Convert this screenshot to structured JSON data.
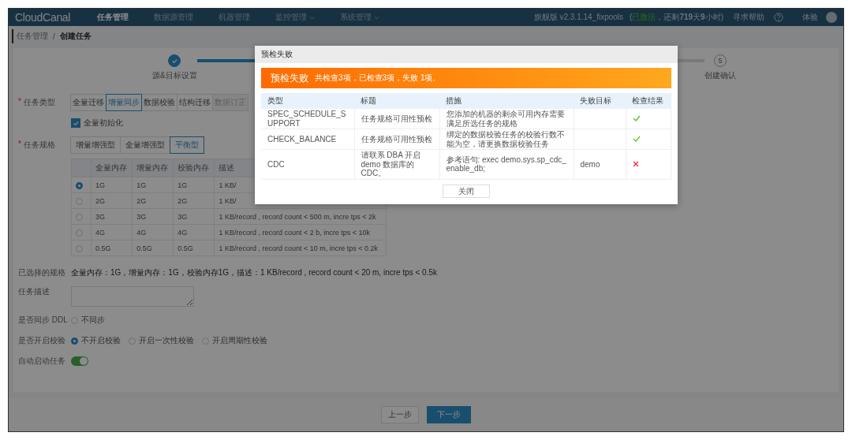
{
  "nav": {
    "logo": "CloudCanal",
    "items": [
      {
        "label": "任务管理",
        "selected": true,
        "dropdown": false
      },
      {
        "label": "数据源管理",
        "selected": false,
        "dropdown": false
      },
      {
        "label": "机器管理",
        "selected": false,
        "dropdown": false
      },
      {
        "label": "监控管理",
        "selected": false,
        "dropdown": true
      },
      {
        "label": "系统管理",
        "selected": false,
        "dropdown": true
      }
    ],
    "version": "旗舰版 v2.3.1.14_fixpools",
    "license": [
      {
        "kind": "plain",
        "text": "("
      },
      {
        "kind": "status",
        "text": "已激活"
      },
      {
        "kind": "plain",
        "text": "，还剩**719**天**9**小时)"
      }
    ],
    "help": "寻求帮助",
    "user": "体验"
  },
  "breadcrumb": [
    {
      "label": "任务管理",
      "current": false
    },
    {
      "label": "/",
      "current": false
    },
    {
      "label": "创建任务",
      "current": true
    }
  ],
  "steps": [
    {
      "label": "源&目标设置",
      "completed": true
    },
    {
      "label": "创建确认",
      "number": "5",
      "completed": false
    }
  ],
  "form": {
    "task_type": {
      "marker": "*",
      "label": "任务类型",
      "options": [
        {
          "label": "全量迁移",
          "selected": false,
          "disabled": false
        },
        {
          "label": "增量同步",
          "selected": true,
          "disabled": false
        },
        {
          "label": "数据校验",
          "selected": false,
          "disabled": false
        },
        {
          "label": "结构迁移",
          "selected": false,
          "disabled": false
        },
        {
          "label": "数据订正",
          "selected": false,
          "disabled": true
        }
      ]
    },
    "full_init": {
      "label": "全量初始化",
      "checked": true
    },
    "spec": {
      "marker": "*",
      "label": "任务规格",
      "options": [
        {
          "label": "增量增强型",
          "selected": false
        },
        {
          "label": "全量增强型",
          "selected": false
        },
        {
          "label": "平衡型",
          "selected": true
        }
      ],
      "columns": [
        "全量内存",
        "增量内存",
        "校验内存",
        "描述"
      ],
      "rows": [
        {
          "selected": true,
          "cells": [
            "1G",
            "1G",
            "1G",
            "1 KB/"
          ]
        },
        {
          "selected": false,
          "cells": [
            "2G",
            "2G",
            "2G",
            "1 KB/"
          ]
        },
        {
          "selected": false,
          "cells": [
            "3G",
            "3G",
            "3G",
            "1 KB/record , record count < 500 m, incre tps < 2k"
          ]
        },
        {
          "selected": false,
          "cells": [
            "4G",
            "4G",
            "4G",
            "1 KB/record , record count < 2 b, incre tps < 10k"
          ]
        },
        {
          "selected": false,
          "cells": [
            "0.5G",
            "0.5G",
            "0.5G",
            "1 KB/record , record count < 10 m, incre tps < 0.2k"
          ]
        }
      ]
    },
    "selected_spec": {
      "label": "已选择的规格",
      "value": "全量内存：1G，增量内存：1G，校验内存1G，描述：1 KB/record , record count < 20 m, incre tps < 0.5k"
    },
    "description": {
      "label": "任务描述"
    },
    "ddl": {
      "label": "是否同步 DDL",
      "options": [
        {
          "label": "不同步",
          "selected": false
        }
      ]
    },
    "verify": {
      "label": "是否开启校验",
      "options": [
        {
          "label": "不开启校验",
          "selected": true
        },
        {
          "label": "开启一次性校验",
          "selected": false
        },
        {
          "label": "开启周期性校验",
          "selected": false
        }
      ]
    },
    "auto_start": {
      "label": "自动启动任务",
      "on": true
    }
  },
  "footer": {
    "prev": "上一步",
    "next": "下一步"
  },
  "modal": {
    "title": "预检失败",
    "banner_title": "预检失败",
    "banner_summary": "共检查3项，已检查3项，失败 1项。",
    "columns": [
      "类型",
      "标题",
      "措施",
      "失败目标",
      "检查结果"
    ],
    "rows": [
      {
        "type": "SPEC_SCHEDULE_SUPPORT",
        "title": "任务规格可用性预检",
        "measure": "您添加的机器的剩余可用内存需要满足所选任务的规格",
        "passed": true
      },
      {
        "type": "CHECK_BALANCE",
        "title": "任务规格可用性预检",
        "measure": "绑定的数据校验任务的校验行数不能为空，请更换数据校验任务",
        "passed": true
      },
      {
        "type": "CDC",
        "title": "请联系 DBA 开启 demo 数据库的 CDC。",
        "measure": "参考语句: exec demo.sys.sp_cdc_enable_db;",
        "target": "demo",
        "passed": false
      }
    ],
    "close": "关闭"
  }
}
